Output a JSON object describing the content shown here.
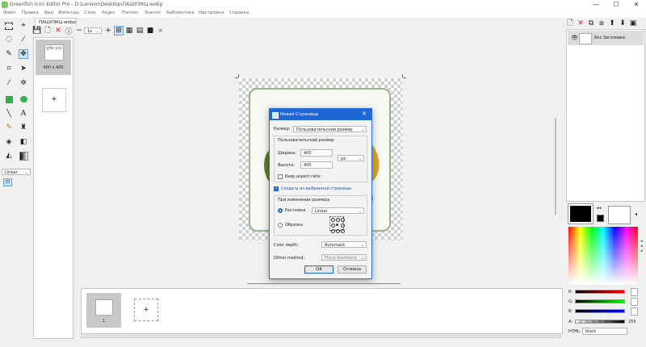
{
  "window": {
    "title": "Greenfish Icon Editor Pro - D:\\Lenovo\\Desktop\\ПАШУЭКЦ.webp",
    "min": "—",
    "max": "☐",
    "close": "✕"
  },
  "menu": [
    "Файл",
    "Правка",
    "Вид",
    "Фильтры",
    "Слои",
    "Pages",
    "Frames",
    "Значок",
    "Библиотека",
    "Настройки",
    "Справка"
  ],
  "tab": {
    "label": "ПАШУЭКЦ.webp"
  },
  "toolbar": {
    "zoom": "1x"
  },
  "tools": {
    "interpolation": "Linear"
  },
  "pages": {
    "thumb_label": "400 x 400",
    "thumb_logo": "gfie pro",
    "add": "+"
  },
  "frames": {
    "index": "1",
    "add": "+"
  },
  "layers": {
    "name": "Без Заголовка"
  },
  "color": {
    "primary": "#000000",
    "secondary": "#ffffff",
    "r_label": "R:",
    "g_label": "G:",
    "b_label": "B:",
    "a_label": "A:",
    "r": 0,
    "g": 0,
    "b": 0,
    "a": 255,
    "a_text": "255",
    "html_label": "HTML:",
    "html_value": "black"
  },
  "dialog": {
    "title": "Новая Страница",
    "size_label": "Размер:",
    "size_value": "Пользовательский размер",
    "custom_group": "Пользовательский размер",
    "width_label": "Ширина:",
    "width_value": "400",
    "height_label": "Высота:",
    "height_value": "400",
    "unit": "px",
    "keep_aspect": "Keep aspect ratio",
    "create_from_selected": "Создать из выбранной страницы",
    "resize_group": "При изменении размера",
    "stretch": "Растяжка",
    "stretch_mode": "Linear",
    "crop": "Обрезка",
    "depth_label": "Color depth:",
    "depth_value": "Automatic",
    "dither_label": "Dither method:",
    "dither_value": "Floyd-Steinberg",
    "ok": "OK",
    "cancel": "Отмена"
  }
}
